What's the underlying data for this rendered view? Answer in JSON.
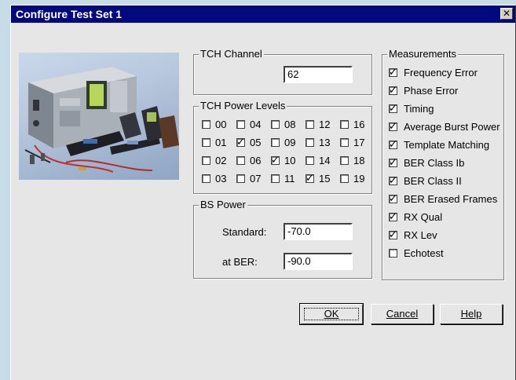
{
  "window": {
    "title": "Configure Test Set 1",
    "close_glyph": "✕"
  },
  "tch_channel": {
    "legend": "TCH Channel",
    "value": "62"
  },
  "tch_power_levels": {
    "legend": "TCH Power Levels",
    "levels": [
      {
        "label": "00",
        "checked": false
      },
      {
        "label": "04",
        "checked": false
      },
      {
        "label": "08",
        "checked": false
      },
      {
        "label": "12",
        "checked": false
      },
      {
        "label": "16",
        "checked": false
      },
      {
        "label": "01",
        "checked": false
      },
      {
        "label": "05",
        "checked": true
      },
      {
        "label": "09",
        "checked": false
      },
      {
        "label": "13",
        "checked": false
      },
      {
        "label": "17",
        "checked": false
      },
      {
        "label": "02",
        "checked": false
      },
      {
        "label": "06",
        "checked": false
      },
      {
        "label": "10",
        "checked": true
      },
      {
        "label": "14",
        "checked": false
      },
      {
        "label": "18",
        "checked": false
      },
      {
        "label": "03",
        "checked": false
      },
      {
        "label": "07",
        "checked": false
      },
      {
        "label": "11",
        "checked": false
      },
      {
        "label": "15",
        "checked": true
      },
      {
        "label": "19",
        "checked": false
      }
    ]
  },
  "bs_power": {
    "legend": "BS Power",
    "standard_label": "Standard:",
    "standard_value": "-70.0",
    "ber_label": "at BER:",
    "ber_value": "-90.0"
  },
  "measurements": {
    "legend": "Measurements",
    "items": [
      {
        "label": "Frequency Error",
        "checked": true
      },
      {
        "label": "Phase Error",
        "checked": true
      },
      {
        "label": "Timing",
        "checked": true
      },
      {
        "label": "Average Burst Power",
        "checked": true
      },
      {
        "label": "Template Matching",
        "checked": true
      },
      {
        "label": "BER Class Ib",
        "checked": true
      },
      {
        "label": "BER Class II",
        "checked": true
      },
      {
        "label": "BER Erased Frames",
        "checked": true
      },
      {
        "label": "RX Qual",
        "checked": true
      },
      {
        "label": "RX Lev",
        "checked": true
      },
      {
        "label": "Echotest",
        "checked": false
      }
    ]
  },
  "buttons": {
    "ok": "OK",
    "cancel": "Cancel",
    "help": "Help"
  },
  "colors": {
    "titlebar": "#02087e",
    "dialog": "#e6e6e6",
    "desktop": "#c8dce8"
  }
}
